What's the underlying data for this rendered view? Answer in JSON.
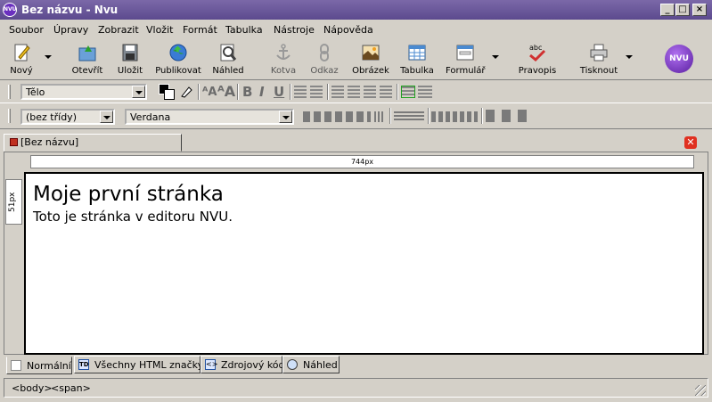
{
  "window": {
    "title": "Bez názvu - Nvu",
    "app_logo": "NVU"
  },
  "menu": [
    "Soubor",
    "Úpravy",
    "Zobrazit",
    "Vložit",
    "Formát",
    "Tabulka",
    "Nástroje",
    "Nápověda"
  ],
  "toolbar": [
    {
      "label": "Nový",
      "icon": "new-doc-icon"
    },
    {
      "label": "Otevřít",
      "icon": "open-icon"
    },
    {
      "label": "Uložit",
      "icon": "save-icon"
    },
    {
      "label": "Publikovat",
      "icon": "publish-icon"
    },
    {
      "label": "Náhled",
      "icon": "preview-icon"
    },
    {
      "label": "Kotva",
      "icon": "anchor-icon"
    },
    {
      "label": "Odkaz",
      "icon": "link-icon"
    },
    {
      "label": "Obrázek",
      "icon": "image-icon"
    },
    {
      "label": "Tabulka",
      "icon": "table-icon"
    },
    {
      "label": "Formulář",
      "icon": "form-icon"
    },
    {
      "label": "Pravopis",
      "icon": "spellcheck-icon"
    },
    {
      "label": "Tisknout",
      "icon": "print-icon"
    }
  ],
  "spell_icon_text": "abc",
  "format": {
    "paragraph_style": "Tělo",
    "class_select": "(bez třídy)",
    "font_select": "Verdana",
    "bold": "B",
    "italic": "I",
    "underline": "U"
  },
  "document": {
    "tab_label": "[Bez názvu]",
    "hruler": "744px",
    "vruler": "51px",
    "heading": "Moje první stránka",
    "body": "Toto je stránka v editoru NVU."
  },
  "view_tabs": [
    "Normální",
    "Všechny HTML značky",
    "Zdrojový kód",
    "Náhled"
  ],
  "view_tab_td": "TD",
  "status": [
    "<body>",
    "<span>"
  ],
  "colors": {
    "title_bar": "#5c4a8e",
    "close_red": "#e03020",
    "face": "#d4d0c8"
  }
}
